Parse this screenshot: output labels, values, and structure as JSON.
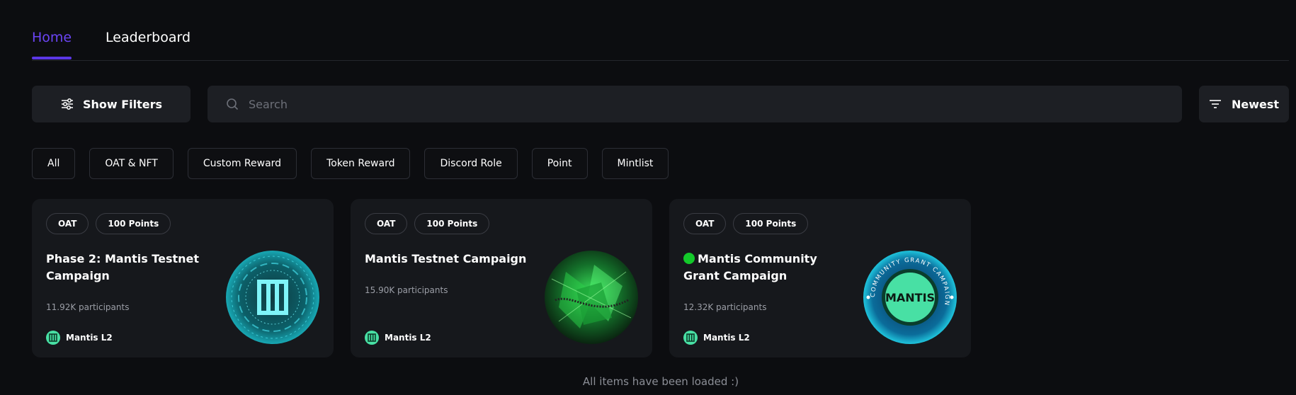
{
  "nav": {
    "tabs": [
      {
        "label": "Home",
        "active": true
      },
      {
        "label": "Leaderboard",
        "active": false
      }
    ]
  },
  "toolbar": {
    "filters_label": "Show Filters",
    "search_placeholder": "Search",
    "search_value": "",
    "sort_label": "Newest"
  },
  "chips": [
    "All",
    "OAT & NFT",
    "Custom Reward",
    "Token Reward",
    "Discord Role",
    "Point",
    "Mintlist"
  ],
  "cards": [
    {
      "tags": [
        "OAT",
        "100 Points"
      ],
      "title": "Phase 2: Mantis Testnet Campaign",
      "participants": "11.92K participants",
      "org": "Mantis L2",
      "image": "mantis-circuit-logo",
      "verified": false
    },
    {
      "tags": [
        "OAT",
        "100 Points"
      ],
      "title": "Mantis Testnet Campaign",
      "participants": "15.90K participants",
      "org": "Mantis L2",
      "image": "mantis-green-crystal",
      "verified": false
    },
    {
      "tags": [
        "OAT",
        "100 Points"
      ],
      "title": "Mantis Community Grant Campaign",
      "participants": "12.32K participants",
      "org": "Mantis L2",
      "image": "mantis-grant-seal",
      "verified": true
    }
  ],
  "badge_ring_text": "COMMUNITY GRANT CAMPAIGN",
  "badge_logo_text": "MANTIS",
  "footer_message": "All items have been loaded :)",
  "colors": {
    "accent": "#5b37e6",
    "background": "#0c0d10",
    "panel": "#1d1f24",
    "card": "#16181c",
    "mantis_green": "#48e0a4",
    "status_green": "#13c92a"
  }
}
